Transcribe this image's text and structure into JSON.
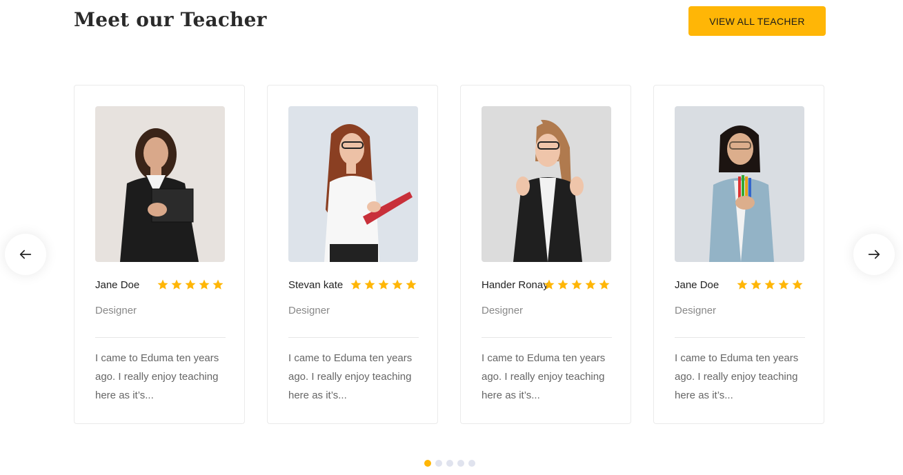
{
  "section": {
    "title": "Meet our Teacher",
    "view_all_label": "VIEW ALL TEACHER"
  },
  "colors": {
    "accent": "#ffb606",
    "star": "#ffb606",
    "inactive_dot": "#e0e3ee"
  },
  "teachers": [
    {
      "name": "Jane Doe",
      "rating": 5,
      "role": "Designer",
      "bio": "I came to Eduma ten years ago. I really enjoy teaching here as it’s..."
    },
    {
      "name": "Stevan kate",
      "rating": 5,
      "role": "Designer",
      "bio": "I came to Eduma ten years ago. I really enjoy teaching here as it’s..."
    },
    {
      "name": "Hander Ronay",
      "rating": 5,
      "role": "Designer",
      "bio": "I came to Eduma ten years ago. I really enjoy teaching here as it’s..."
    },
    {
      "name": "Jane Doe",
      "rating": 5,
      "role": "Designer",
      "bio": "I came to Eduma ten years ago. I really enjoy teaching here as it’s..."
    }
  ],
  "navigation": {
    "prev_icon": "arrow-left-icon",
    "next_icon": "arrow-right-icon"
  },
  "pagination": {
    "total_pages": 5,
    "active_page": 1
  }
}
